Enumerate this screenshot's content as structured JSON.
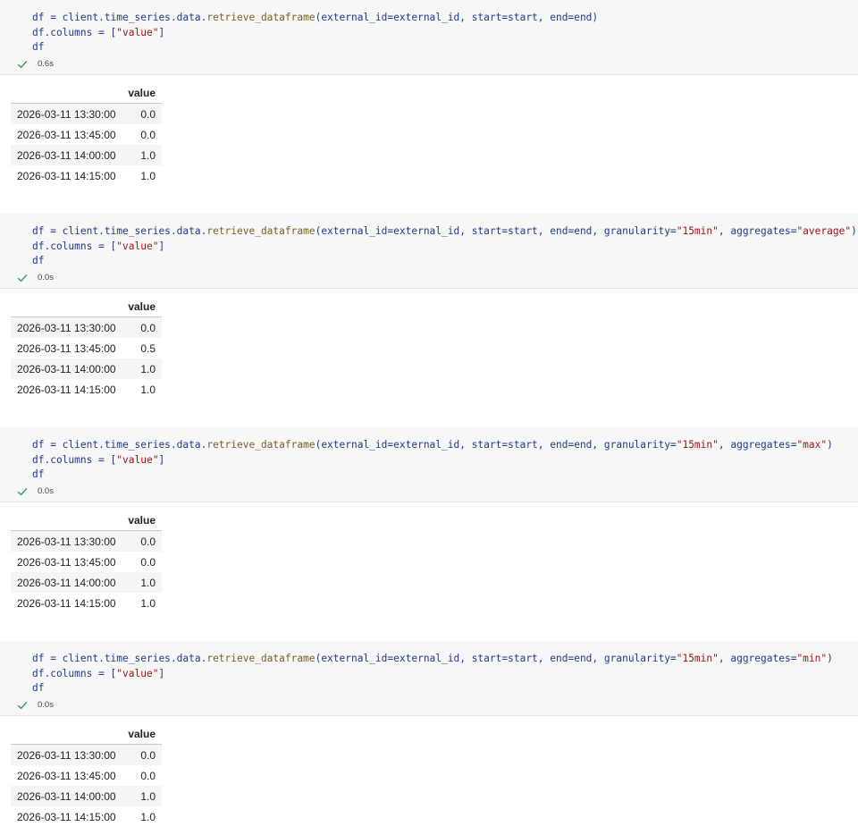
{
  "cells": [
    {
      "code": [
        [
          {
            "t": "df = client.time_series.data."
          },
          {
            "t": "retrieve_dataframe",
            "c": "fn"
          },
          {
            "t": "(external_id=external_id, start=start, end=end)"
          }
        ],
        [
          {
            "t": "df.columns = ["
          },
          {
            "t": "\"value\"",
            "c": "str"
          },
          {
            "t": "]"
          }
        ],
        [
          {
            "t": "df"
          }
        ]
      ],
      "exec_time": "0.6s",
      "table": {
        "column": "value",
        "rows": [
          {
            "index": "2026-03-11 13:30:00",
            "value": "0.0"
          },
          {
            "index": "2026-03-11 13:45:00",
            "value": "0.0"
          },
          {
            "index": "2026-03-11 14:00:00",
            "value": "1.0"
          },
          {
            "index": "2026-03-11 14:15:00",
            "value": "1.0"
          }
        ]
      }
    },
    {
      "code": [
        [
          {
            "t": "df = client.time_series.data."
          },
          {
            "t": "retrieve_dataframe",
            "c": "fn"
          },
          {
            "t": "(external_id=external_id, start=start, end=end, granularity="
          },
          {
            "t": "\"15min\"",
            "c": "str"
          },
          {
            "t": ", aggregates="
          },
          {
            "t": "\"average\"",
            "c": "str"
          },
          {
            "t": ")"
          }
        ],
        [
          {
            "t": "df.columns = ["
          },
          {
            "t": "\"value\"",
            "c": "str"
          },
          {
            "t": "]"
          }
        ],
        [
          {
            "t": "df"
          }
        ]
      ],
      "exec_time": "0.0s",
      "table": {
        "column": "value",
        "rows": [
          {
            "index": "2026-03-11 13:30:00",
            "value": "0.0"
          },
          {
            "index": "2026-03-11 13:45:00",
            "value": "0.5"
          },
          {
            "index": "2026-03-11 14:00:00",
            "value": "1.0"
          },
          {
            "index": "2026-03-11 14:15:00",
            "value": "1.0"
          }
        ]
      }
    },
    {
      "code": [
        [
          {
            "t": "df = client.time_series.data."
          },
          {
            "t": "retrieve_dataframe",
            "c": "fn"
          },
          {
            "t": "(external_id=external_id, start=start, end=end, granularity="
          },
          {
            "t": "\"15min\"",
            "c": "str"
          },
          {
            "t": ", aggregates="
          },
          {
            "t": "\"max\"",
            "c": "str"
          },
          {
            "t": ")"
          }
        ],
        [
          {
            "t": "df.columns = ["
          },
          {
            "t": "\"value\"",
            "c": "str"
          },
          {
            "t": "]"
          }
        ],
        [
          {
            "t": "df"
          }
        ]
      ],
      "exec_time": "0.0s",
      "table": {
        "column": "value",
        "rows": [
          {
            "index": "2026-03-11 13:30:00",
            "value": "0.0"
          },
          {
            "index": "2026-03-11 13:45:00",
            "value": "0.0"
          },
          {
            "index": "2026-03-11 14:00:00",
            "value": "1.0"
          },
          {
            "index": "2026-03-11 14:15:00",
            "value": "1.0"
          }
        ]
      }
    },
    {
      "code": [
        [
          {
            "t": "df = client.time_series.data."
          },
          {
            "t": "retrieve_dataframe",
            "c": "fn"
          },
          {
            "t": "(external_id=external_id, start=start, end=end, granularity="
          },
          {
            "t": "\"15min\"",
            "c": "str"
          },
          {
            "t": ", aggregates="
          },
          {
            "t": "\"min\"",
            "c": "str"
          },
          {
            "t": ")"
          }
        ],
        [
          {
            "t": "df.columns = ["
          },
          {
            "t": "\"value\"",
            "c": "str"
          },
          {
            "t": "]"
          }
        ],
        [
          {
            "t": "df"
          }
        ]
      ],
      "exec_time": "0.0s",
      "table": {
        "column": "value",
        "rows": [
          {
            "index": "2026-03-11 13:30:00",
            "value": "0.0"
          },
          {
            "index": "2026-03-11 13:45:00",
            "value": "0.0"
          },
          {
            "index": "2026-03-11 14:00:00",
            "value": "1.0"
          },
          {
            "index": "2026-03-11 14:15:00",
            "value": "1.0"
          }
        ]
      }
    }
  ],
  "colors": {
    "check": "#3c9a5f",
    "function": "#795e26",
    "string": "#a31515",
    "identifier": "#1f3a8a"
  },
  "icons": {
    "status": "check-icon"
  }
}
